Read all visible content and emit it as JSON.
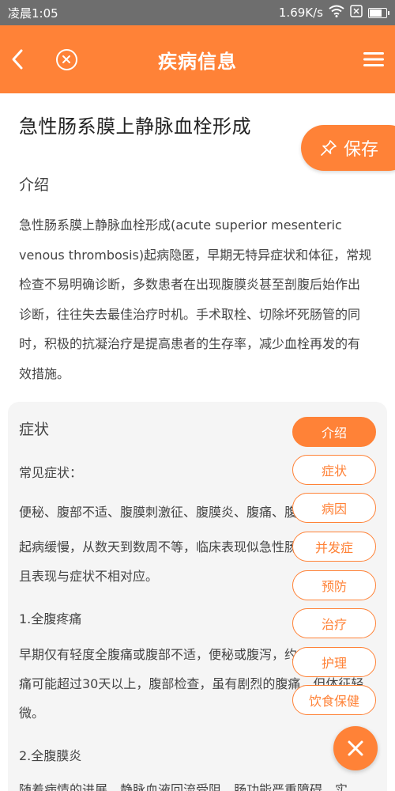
{
  "status_bar": {
    "time": "凌晨1:05",
    "speed": "1.69K/s",
    "icons": [
      "wifi-icon",
      "sim-icon",
      "battery-icon"
    ]
  },
  "app_bar": {
    "title": "疾病信息",
    "icons": [
      "back-arrow-icon",
      "close-circle-icon",
      "menu-icon"
    ],
    "background": "#ff8237"
  },
  "disease": {
    "title": "急性肠系膜上静脉血栓形成",
    "save_label": "保存"
  },
  "intro": {
    "heading": "介绍",
    "lines": [
      "急性肠系膜上静脉血栓形成(acute superior mesenteric",
      "venous thrombosis)起病隐匿，早期无特异症状和体征，常规",
      "检查不易明确诊断，多数患者在出现腹膜炎甚至剖腹后始作出",
      "诊断，往往失去最佳治疗时机。手术取栓、切除坏死肠管的同",
      "时，积极的抗凝治疗是提高患者的生存率，减少血栓再发的有",
      "效措施。"
    ]
  },
  "symptoms": {
    "heading": "症状",
    "common_label": "常见症状：",
    "common_list": "便秘、腹部不适、腹膜刺激征、腹膜炎、腹痛、腹胀",
    "para1_lines": [
      "起病缓慢，从数天到数周不等，临床表现似急性肠",
      "且表现与症状不相对应。"
    ],
    "sub1": "1.全腹疼痛",
    "para2_lines": [
      "早期仅有轻度全腹痛或腹部不适，便秘或腹泻，约",
      "痛可能超过30天以上，腹部检查，虽有剧烈的腹痛，但体征轻",
      "微。"
    ],
    "sub2": "2.全腹膜炎",
    "para3_lines": [
      "随着病情的进展，静脉血液回流受阻，肠功能严重障碍，实..."
    ]
  },
  "nav": {
    "items": [
      "介绍",
      "症状",
      "病因",
      "并发症",
      "预防",
      "治疗",
      "护理",
      "饮食保健"
    ],
    "active_index": 0
  }
}
